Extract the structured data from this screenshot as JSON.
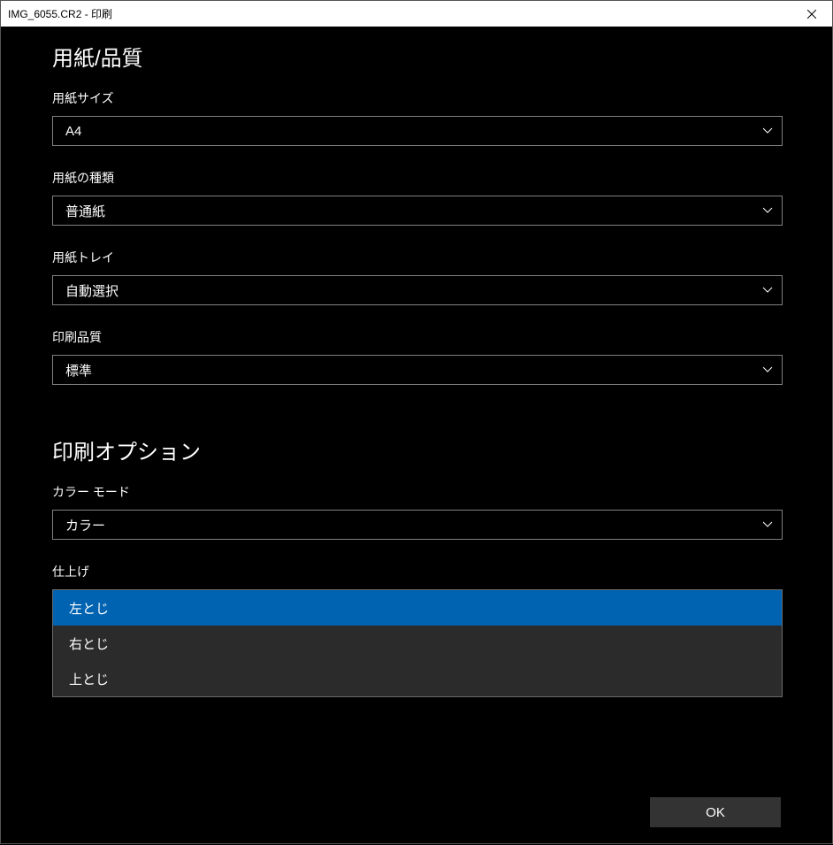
{
  "window": {
    "title": "IMG_6055.CR2 - 印刷"
  },
  "section1": {
    "heading": "用紙/品質"
  },
  "section2": {
    "heading": "印刷オプション"
  },
  "fields": {
    "paperSize": {
      "label": "用紙サイズ",
      "value": "A4"
    },
    "paperType": {
      "label": "用紙の種類",
      "value": "普通紙"
    },
    "paperTray": {
      "label": "用紙トレイ",
      "value": "自動選択"
    },
    "printQuality": {
      "label": "印刷品質",
      "value": "標準"
    },
    "colorMode": {
      "label": "カラー モード",
      "value": "カラー"
    },
    "finishing": {
      "label": "仕上げ",
      "options": [
        "左とじ",
        "右とじ",
        "上とじ"
      ],
      "selectedIndex": 0
    }
  },
  "buttons": {
    "ok": "OK"
  }
}
